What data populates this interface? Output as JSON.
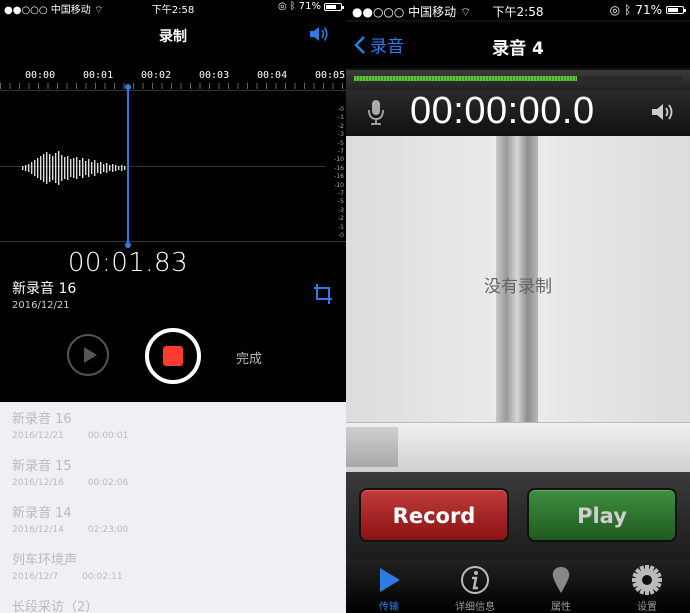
{
  "left": {
    "status": {
      "carrier": "●●○○○ 中国移动 ⌔",
      "time": "下午2:58",
      "battery": "71%",
      "battery_level": 0.71
    },
    "title": "录制",
    "timeline": [
      "00:00",
      "00:01",
      "00:02",
      "00:03",
      "00:04",
      "00:05"
    ],
    "db_scale": [
      "-0",
      "-1",
      "-2",
      "-3",
      "-5",
      "-7",
      "-10",
      "-16",
      "-16",
      "-10",
      "-7",
      "-5",
      "-3",
      "-2",
      "-1",
      "-0"
    ],
    "current_time": "00:01.83",
    "recording": {
      "name": "新录音 16",
      "date": "2016/12/21"
    },
    "done_label": "完成",
    "list": [
      {
        "name": "新录音 16",
        "date": "2016/12/21",
        "duration": "00:00:01"
      },
      {
        "name": "新录音 15",
        "date": "2016/12/16",
        "duration": "00:02:06"
      },
      {
        "name": "新录音 14",
        "date": "2016/12/14",
        "duration": "02:23:00"
      },
      {
        "name": "列车环境声",
        "date": "2016/12/7",
        "duration": "00:02:11"
      },
      {
        "name": "长段采访（2）"
      }
    ]
  },
  "right": {
    "status": {
      "carrier": "●●○○○ 中国移动 ⌔",
      "time": "下午2:58",
      "battery": "71%",
      "battery_level": 0.71
    },
    "back_label": "录音",
    "title": "录音 4",
    "meter_level": 0.68,
    "timer": "00:00:00.0",
    "empty_text": "没有录制",
    "record_label": "Record",
    "play_label": "Play",
    "tabs": [
      {
        "label": "传输",
        "icon": "play-triangle-icon",
        "active": true
      },
      {
        "label": "详细信息",
        "icon": "info-icon",
        "active": false
      },
      {
        "label": "属性",
        "icon": "pin-icon",
        "active": false
      },
      {
        "label": "设置",
        "icon": "gear-icon",
        "active": false
      }
    ]
  },
  "colors": {
    "accent_blue": "#2d7be5",
    "stop_red": "#ff3b30",
    "record_red": "#a82020",
    "play_green": "#2f7a2f",
    "meter_green": "#5cc43a"
  }
}
